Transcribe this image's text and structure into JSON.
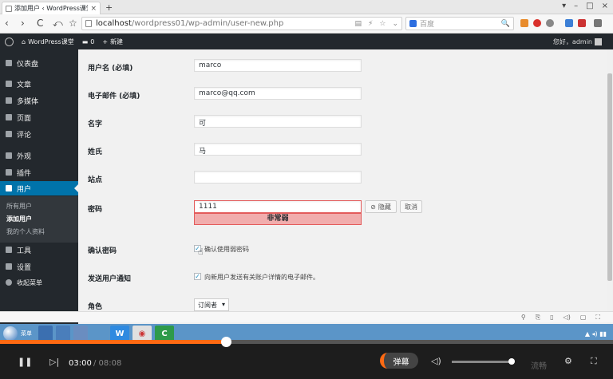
{
  "browser": {
    "tab_title": "添加用户 ‹ WordPress课堂",
    "tab_close": "×",
    "new_tab": "+",
    "window_controls": [
      "▾",
      "–",
      "□",
      "×"
    ],
    "nav": {
      "back": "‹",
      "forward": "›",
      "reload": "C",
      "undo": "⤺",
      "bookmark": "☆"
    },
    "url_host": "localhost",
    "url_path": "/wordpress01/wp-admin/user-new.php",
    "url_icons": [
      "▤",
      "⚡",
      "☆",
      "⌄"
    ],
    "search_placeholder": "百度",
    "search_icon": "🔍"
  },
  "adminbar": {
    "site_name": "WordPress课堂",
    "comments_count": "0",
    "new_label": "新建",
    "howdy": "您好，admin"
  },
  "sidemenu": {
    "items": [
      {
        "label": "仪表盘",
        "icon": "dashboard-icon"
      },
      {
        "label": "文章",
        "icon": "pin-icon"
      },
      {
        "label": "多媒体",
        "icon": "media-icon"
      },
      {
        "label": "页面",
        "icon": "page-icon"
      },
      {
        "label": "评论",
        "icon": "comment-icon"
      },
      {
        "label": "外观",
        "icon": "brush-icon"
      },
      {
        "label": "插件",
        "icon": "plugin-icon"
      },
      {
        "label": "用户",
        "icon": "user-icon"
      },
      {
        "label": "工具",
        "icon": "wrench-icon"
      },
      {
        "label": "设置",
        "icon": "settings-icon"
      },
      {
        "label": "收起菜单",
        "icon": "collapse-icon"
      }
    ],
    "submenu": [
      "所有用户",
      "添加用户",
      "我的个人资料"
    ]
  },
  "form": {
    "username_label": "用户名 (必填)",
    "username_value": "marco",
    "email_label": "电子邮件 (必填)",
    "email_value": "marco@qq.com",
    "firstname_label": "名字",
    "firstname_value": "可",
    "lastname_label": "姓氏",
    "lastname_value": "马",
    "website_label": "站点",
    "website_value": "",
    "password_label": "密码",
    "password_value": "1111",
    "hide_label": "隐藏",
    "cancel_label": "取消",
    "strength_label": "非常弱",
    "confirm_label": "确认密码",
    "confirm_text": "确认使用弱密码",
    "notify_label": "发送用户通知",
    "notify_text": "向新用户发送有关账户详情的电子邮件。",
    "role_label": "角色",
    "role_value": "订阅者"
  },
  "statusbar": {
    "icons": [
      "⚲",
      "⎘",
      "▯",
      "◁)",
      "▢",
      "⛶"
    ]
  },
  "taskbar": {
    "menu_label": "菜单",
    "apps": [
      "W",
      "◉",
      "C"
    ],
    "tray": "▲ ◂) ▮▮"
  },
  "player": {
    "current_time": "03:00",
    "total_time": "/ 08:08",
    "progress_fraction": 0.369,
    "danmu_label": "弹幕",
    "quality_label": "流畅"
  },
  "colors": {
    "wp_dark": "#23282d",
    "wp_blue": "#0073aa",
    "strength_bg": "#f1adad",
    "player_accent": "#ff6a13"
  }
}
